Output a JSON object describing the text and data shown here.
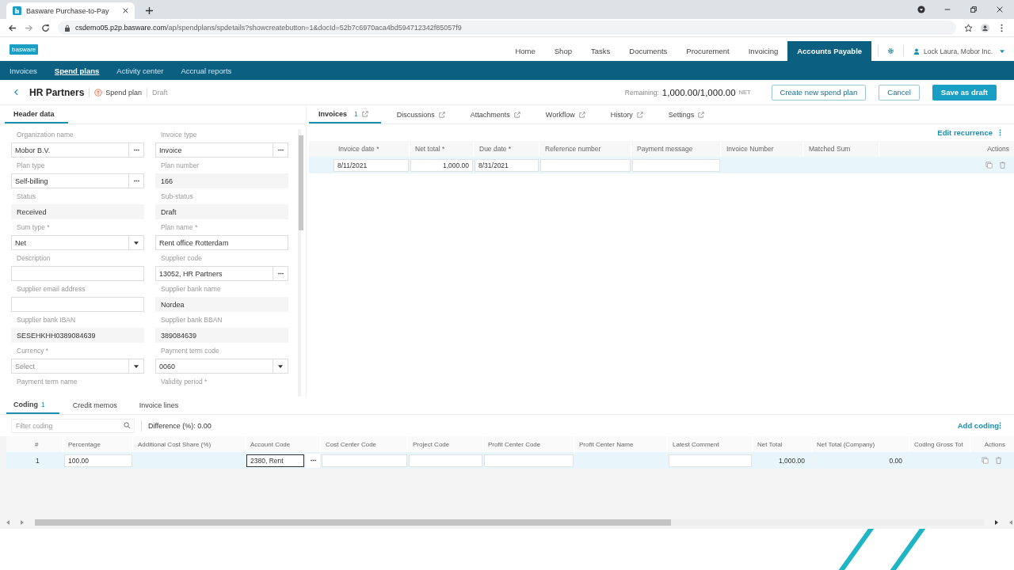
{
  "browser": {
    "tab_title": "Basware Purchase-to-Pay",
    "url_host": "csdemo05.p2p.basware.com",
    "url_path": "/ap/spendplans/spdetails?showcreatebutton=1&docId=52b7c6970aca4bd594712342f85057f9"
  },
  "app": {
    "logo": "basware",
    "user": "Lock Laura, Mobor Inc.",
    "nav": [
      {
        "label": "Home",
        "selected": false
      },
      {
        "label": "Shop",
        "selected": false
      },
      {
        "label": "Tasks",
        "selected": false
      },
      {
        "label": "Documents",
        "selected": false
      },
      {
        "label": "Procurement",
        "selected": false
      },
      {
        "label": "Invoicing",
        "selected": false
      },
      {
        "label": "Accounts Payable",
        "selected": true
      }
    ]
  },
  "subnav": [
    {
      "label": "Invoices",
      "selected": false
    },
    {
      "label": "Spend plans",
      "selected": true
    },
    {
      "label": "Activity center",
      "selected": false
    },
    {
      "label": "Accrual reports",
      "selected": false
    }
  ],
  "title": {
    "name": "HR Partners",
    "type": "Spend plan",
    "status": "Draft",
    "remaining_label": "Remaining:",
    "remaining_value": "1,000.00/1,000.00",
    "remaining_unit": "NET"
  },
  "actions": [
    {
      "label": "Create new spend plan",
      "kind": "outline"
    },
    {
      "label": "Cancel",
      "kind": "outline"
    },
    {
      "label": "Save as draft",
      "kind": "primary"
    }
  ],
  "header_data": {
    "tab": "Header data",
    "fields": [
      {
        "label": "Organization name",
        "value": "Mobor B.V.",
        "kind": "lookup"
      },
      {
        "label": "Invoice type",
        "value": "Invoice",
        "kind": "lookup"
      },
      {
        "label": "Plan type",
        "value": "Self-billing",
        "kind": "lookup"
      },
      {
        "label": "Plan number",
        "value": "166",
        "kind": "readonly"
      },
      {
        "label": "Status",
        "value": "Received",
        "kind": "readonly"
      },
      {
        "label": "Sub-status",
        "value": "Draft",
        "kind": "readonly"
      },
      {
        "label": "Sum type *",
        "value": "Net",
        "kind": "select"
      },
      {
        "label": "Plan name *",
        "value": "Rent office Rotterdam",
        "kind": "text"
      },
      {
        "label": "Description",
        "kind": "text"
      },
      {
        "label": "Supplier code",
        "value": "13052, HR Partners",
        "kind": "lookup"
      },
      {
        "label": "Supplier email address",
        "kind": "text"
      },
      {
        "label": "Supplier bank name",
        "value": "Nordea",
        "kind": "readonly"
      },
      {
        "label": "Supplier bank IBAN",
        "value": "SESEHKHH0389084639",
        "kind": "readonly"
      },
      {
        "label": "Supplier bank BBAN",
        "value": "389084639",
        "kind": "readonly"
      },
      {
        "label": "Currency *",
        "placeholder": "Select",
        "kind": "select"
      },
      {
        "label": "Payment term code",
        "value": "0060",
        "kind": "select"
      },
      {
        "label": "Payment term name",
        "kind": "cut"
      },
      {
        "label": "Validity period *",
        "kind": "cut"
      }
    ]
  },
  "detail_tabs": [
    {
      "label": "Invoices",
      "count": "1",
      "selected": true
    },
    {
      "label": "Discussions",
      "selected": false
    },
    {
      "label": "Attachments",
      "selected": false
    },
    {
      "label": "Workflow",
      "selected": false
    },
    {
      "label": "History",
      "selected": false
    },
    {
      "label": "Settings",
      "selected": false
    }
  ],
  "invoices": {
    "action": "Edit recurrence",
    "actions_column": "Actions",
    "columns": [
      "Invoice date *",
      "Net total *",
      "Due date *",
      "Reference number",
      "Payment message",
      "Invoice Number",
      "Matched Sum"
    ],
    "rows": [
      {
        "cells": [
          {
            "value": "8/11/2021",
            "kind": "input"
          },
          {
            "value": "1,000.00",
            "kind": "input",
            "numeric": true
          },
          {
            "value": "8/31/2021",
            "kind": "input"
          },
          {
            "kind": "input"
          },
          {
            "kind": "input"
          },
          {
            "kind": "plain"
          },
          {
            "kind": "plain"
          }
        ]
      }
    ]
  },
  "coding": {
    "tabs": [
      {
        "label": "Coding",
        "count": "1",
        "selected": true
      },
      {
        "label": "Credit memos",
        "selected": false
      },
      {
        "label": "Invoice lines",
        "selected": false
      }
    ],
    "filter_placeholder": "Filter coding",
    "difference": "Difference (%): 0.00",
    "action": "Add coding",
    "actions_column": "Actions",
    "columns": [
      "#",
      "Percentage",
      "Additional Cost Share (%)",
      "Account Code",
      "Cost Center Code",
      "Project Code",
      "Profit Center Code",
      "Profit Center Name",
      "Latest Comment",
      "Net Total",
      "Net Total (Company)",
      "Coding Gross Tot"
    ],
    "rows": [
      {
        "cells": [
          {
            "value": "1",
            "kind": "plain"
          },
          {
            "value": "100.00",
            "kind": "input"
          },
          {
            "kind": "plain"
          },
          {
            "value": "2380, Rent",
            "kind": "lookup"
          },
          {
            "kind": "input"
          },
          {
            "kind": "input"
          },
          {
            "kind": "input"
          },
          {
            "kind": "plain"
          },
          {
            "kind": "input"
          },
          {
            "value": "1,000.00",
            "kind": "plain",
            "numeric": true
          },
          {
            "value": "0.00",
            "kind": "plain",
            "numeric": true
          },
          {
            "kind": "plain"
          }
        ]
      }
    ]
  }
}
